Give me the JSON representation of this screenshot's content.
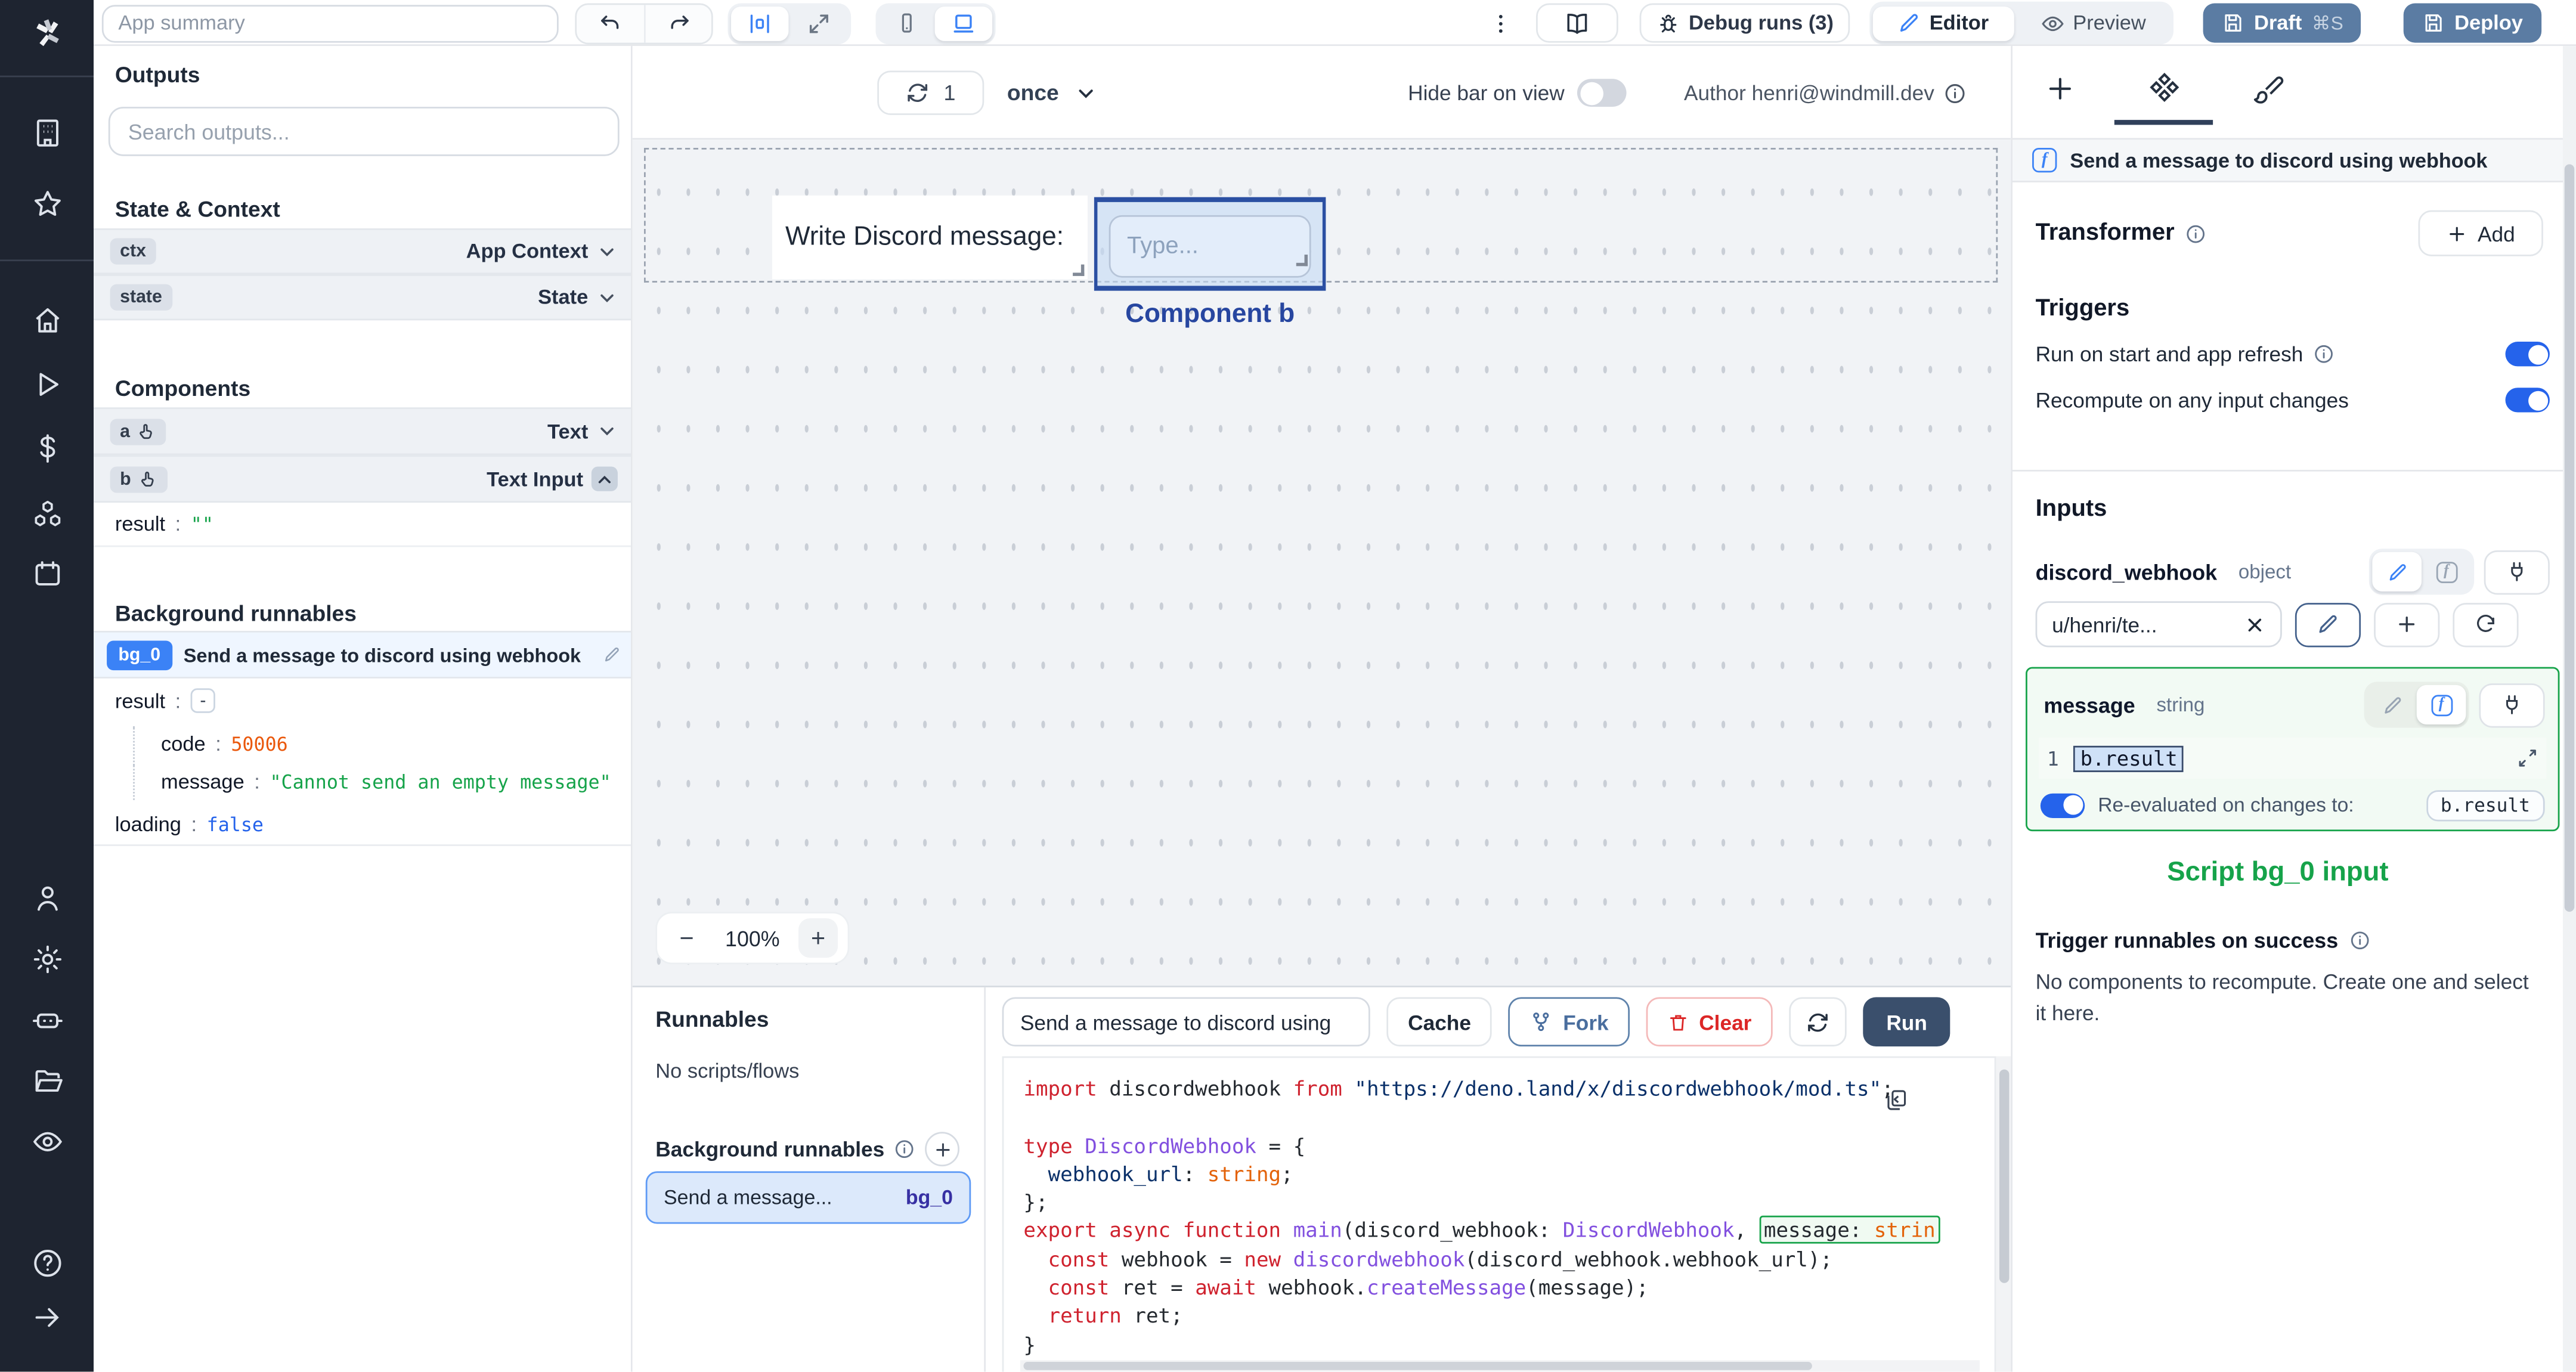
{
  "topbar": {
    "app_summary_placeholder": "App summary",
    "debug_runs": "Debug runs (3)",
    "editor": "Editor",
    "preview": "Preview",
    "draft": "Draft",
    "draft_shortcut": "⌘S",
    "deploy": "Deploy"
  },
  "outputs_panel": {
    "title": "Outputs",
    "search_placeholder": "Search outputs...",
    "state_context_title": "State & Context",
    "ctx_badge": "ctx",
    "ctx_type": "App Context",
    "state_badge": "state",
    "state_type": "State",
    "components_title": "Components",
    "a_badge": "a",
    "a_type": "Text",
    "b_badge": "b",
    "b_type": "Text Input",
    "colon": ":",
    "b_result_key": "result",
    "b_result_value": "\"\"",
    "background_title": "Background runnables",
    "bg0_badge": "bg_0",
    "bg0_title": "Send a message to discord using webhook",
    "result_key": "result",
    "result_collapse": "-",
    "code_key": "code",
    "code_value": "50006",
    "message_key": "message",
    "message_value": "\"Cannot send an empty message\"",
    "loading_key": "loading",
    "loading_value": "false"
  },
  "canvas": {
    "refresh_count": "1",
    "frequency": "once",
    "hide_bar_label": "Hide bar on view",
    "author": "Author henri@windmill.dev",
    "text_component": "Write Discord message:",
    "input_placeholder": "Type...",
    "selected_label": "Component b",
    "zoom_out": "−",
    "zoom_level": "100%",
    "zoom_in": "+"
  },
  "runnables": {
    "title": "Runnables",
    "empty": "No scripts/flows",
    "background_title": "Background runnables",
    "item_label": "Send a message...",
    "item_badge": "bg_0"
  },
  "code_panel": {
    "tab": "Send a message to discord using",
    "cache": "Cache",
    "fork": "Fork",
    "clear": "Clear",
    "run": "Run",
    "lines": [
      [
        [
          "k",
          "import "
        ],
        [
          "p",
          "discordwebhook "
        ],
        [
          "k",
          "from "
        ],
        [
          "s",
          "\"https://deno.land/x/discordwebhook/mod.ts\""
        ],
        [
          "p",
          ";"
        ]
      ],
      [],
      [
        [
          "k",
          "type "
        ],
        [
          "t",
          "DiscordWebhook"
        ],
        [
          "p",
          " = {"
        ]
      ],
      [
        [
          "p",
          "  "
        ],
        [
          "s",
          "webhook_url"
        ],
        [
          "p",
          ": "
        ],
        [
          "o",
          "string"
        ],
        [
          "p",
          ";"
        ]
      ],
      [
        [
          "p",
          "};"
        ]
      ],
      [
        [
          "k",
          "export async function "
        ],
        [
          "fn",
          "main"
        ],
        [
          "p",
          "(discord_webhook: "
        ],
        [
          "t",
          "DiscordWebhook"
        ],
        [
          "p",
          ", "
        ],
        [
          "hl",
          [
            [
              "p",
              "message: "
            ],
            [
              "o",
              "strin"
            ]
          ]
        ]
      ],
      [
        [
          "p",
          "  "
        ],
        [
          "k",
          "const "
        ],
        [
          "p",
          "webhook = "
        ],
        [
          "k",
          "new "
        ],
        [
          "fn",
          "discordwebhook"
        ],
        [
          "p",
          "(discord_webhook.webhook_url);"
        ]
      ],
      [
        [
          "p",
          "  "
        ],
        [
          "k",
          "const "
        ],
        [
          "p",
          "ret = "
        ],
        [
          "k",
          "await "
        ],
        [
          "p",
          "webhook."
        ],
        [
          "fn",
          "createMessage"
        ],
        [
          "p",
          "(message);"
        ]
      ],
      [
        [
          "p",
          "  "
        ],
        [
          "k",
          "return "
        ],
        [
          "p",
          "ret;"
        ]
      ],
      [
        [
          "p",
          "}"
        ]
      ]
    ]
  },
  "right_panel": {
    "header": "Send a message to discord using webhook",
    "transformer_title": "Transformer",
    "add_label": "Add",
    "triggers_title": "Triggers",
    "trigger_row_1": "Run on start and app refresh",
    "trigger_row_2": "Recompute on any input changes",
    "inputs_title": "Inputs",
    "discord_webhook_name": "discord_webhook",
    "discord_webhook_type": "object",
    "discord_webhook_value": "u/henri/te...",
    "message_name": "message",
    "message_type": "string",
    "message_line_no": "1",
    "message_expr": "b.result",
    "reeval_label": "Re-evaluated on changes to:",
    "reeval_target": "b.result",
    "script_input_label": "Script bg_0 input",
    "on_success_title": "Trigger runnables on success",
    "on_success_empty": "No components to recompute. Create one and select it here."
  },
  "colors": {
    "accent_blue": "#3b82f6",
    "slate_button": "#5b7ca3",
    "run_button": "#3a4f6c",
    "selection_green": "#16a34a",
    "component_blue": "#2b4fa2",
    "sidebar_bg": "#1e2430"
  }
}
